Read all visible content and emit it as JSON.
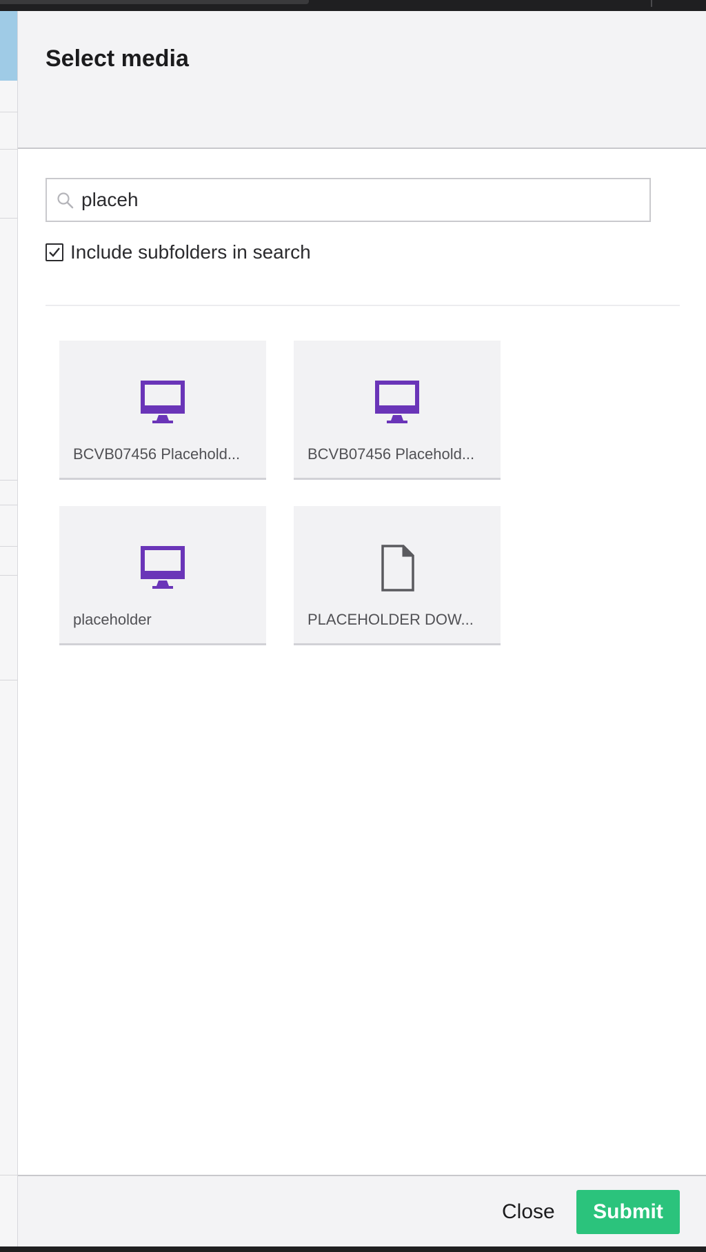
{
  "dialog": {
    "title": "Select media",
    "search": {
      "value": "placeh",
      "icon": "search-icon"
    },
    "include_subfolders": {
      "label": "Include subfolders in search",
      "checked": true
    },
    "items": [
      {
        "label": "BCVB07456 Placehold...",
        "icon": "monitor-icon"
      },
      {
        "label": "BCVB07456 Placehold...",
        "icon": "monitor-icon"
      },
      {
        "label": "placeholder",
        "icon": "monitor-icon"
      },
      {
        "label": "PLACEHOLDER DOW...",
        "icon": "file-icon"
      }
    ],
    "footer": {
      "close_label": "Close",
      "submit_label": "Submit"
    }
  },
  "colors": {
    "accent_purple": "#6a35b8",
    "submit_green": "#2bc37c",
    "header_bg": "#f3f3f5"
  }
}
